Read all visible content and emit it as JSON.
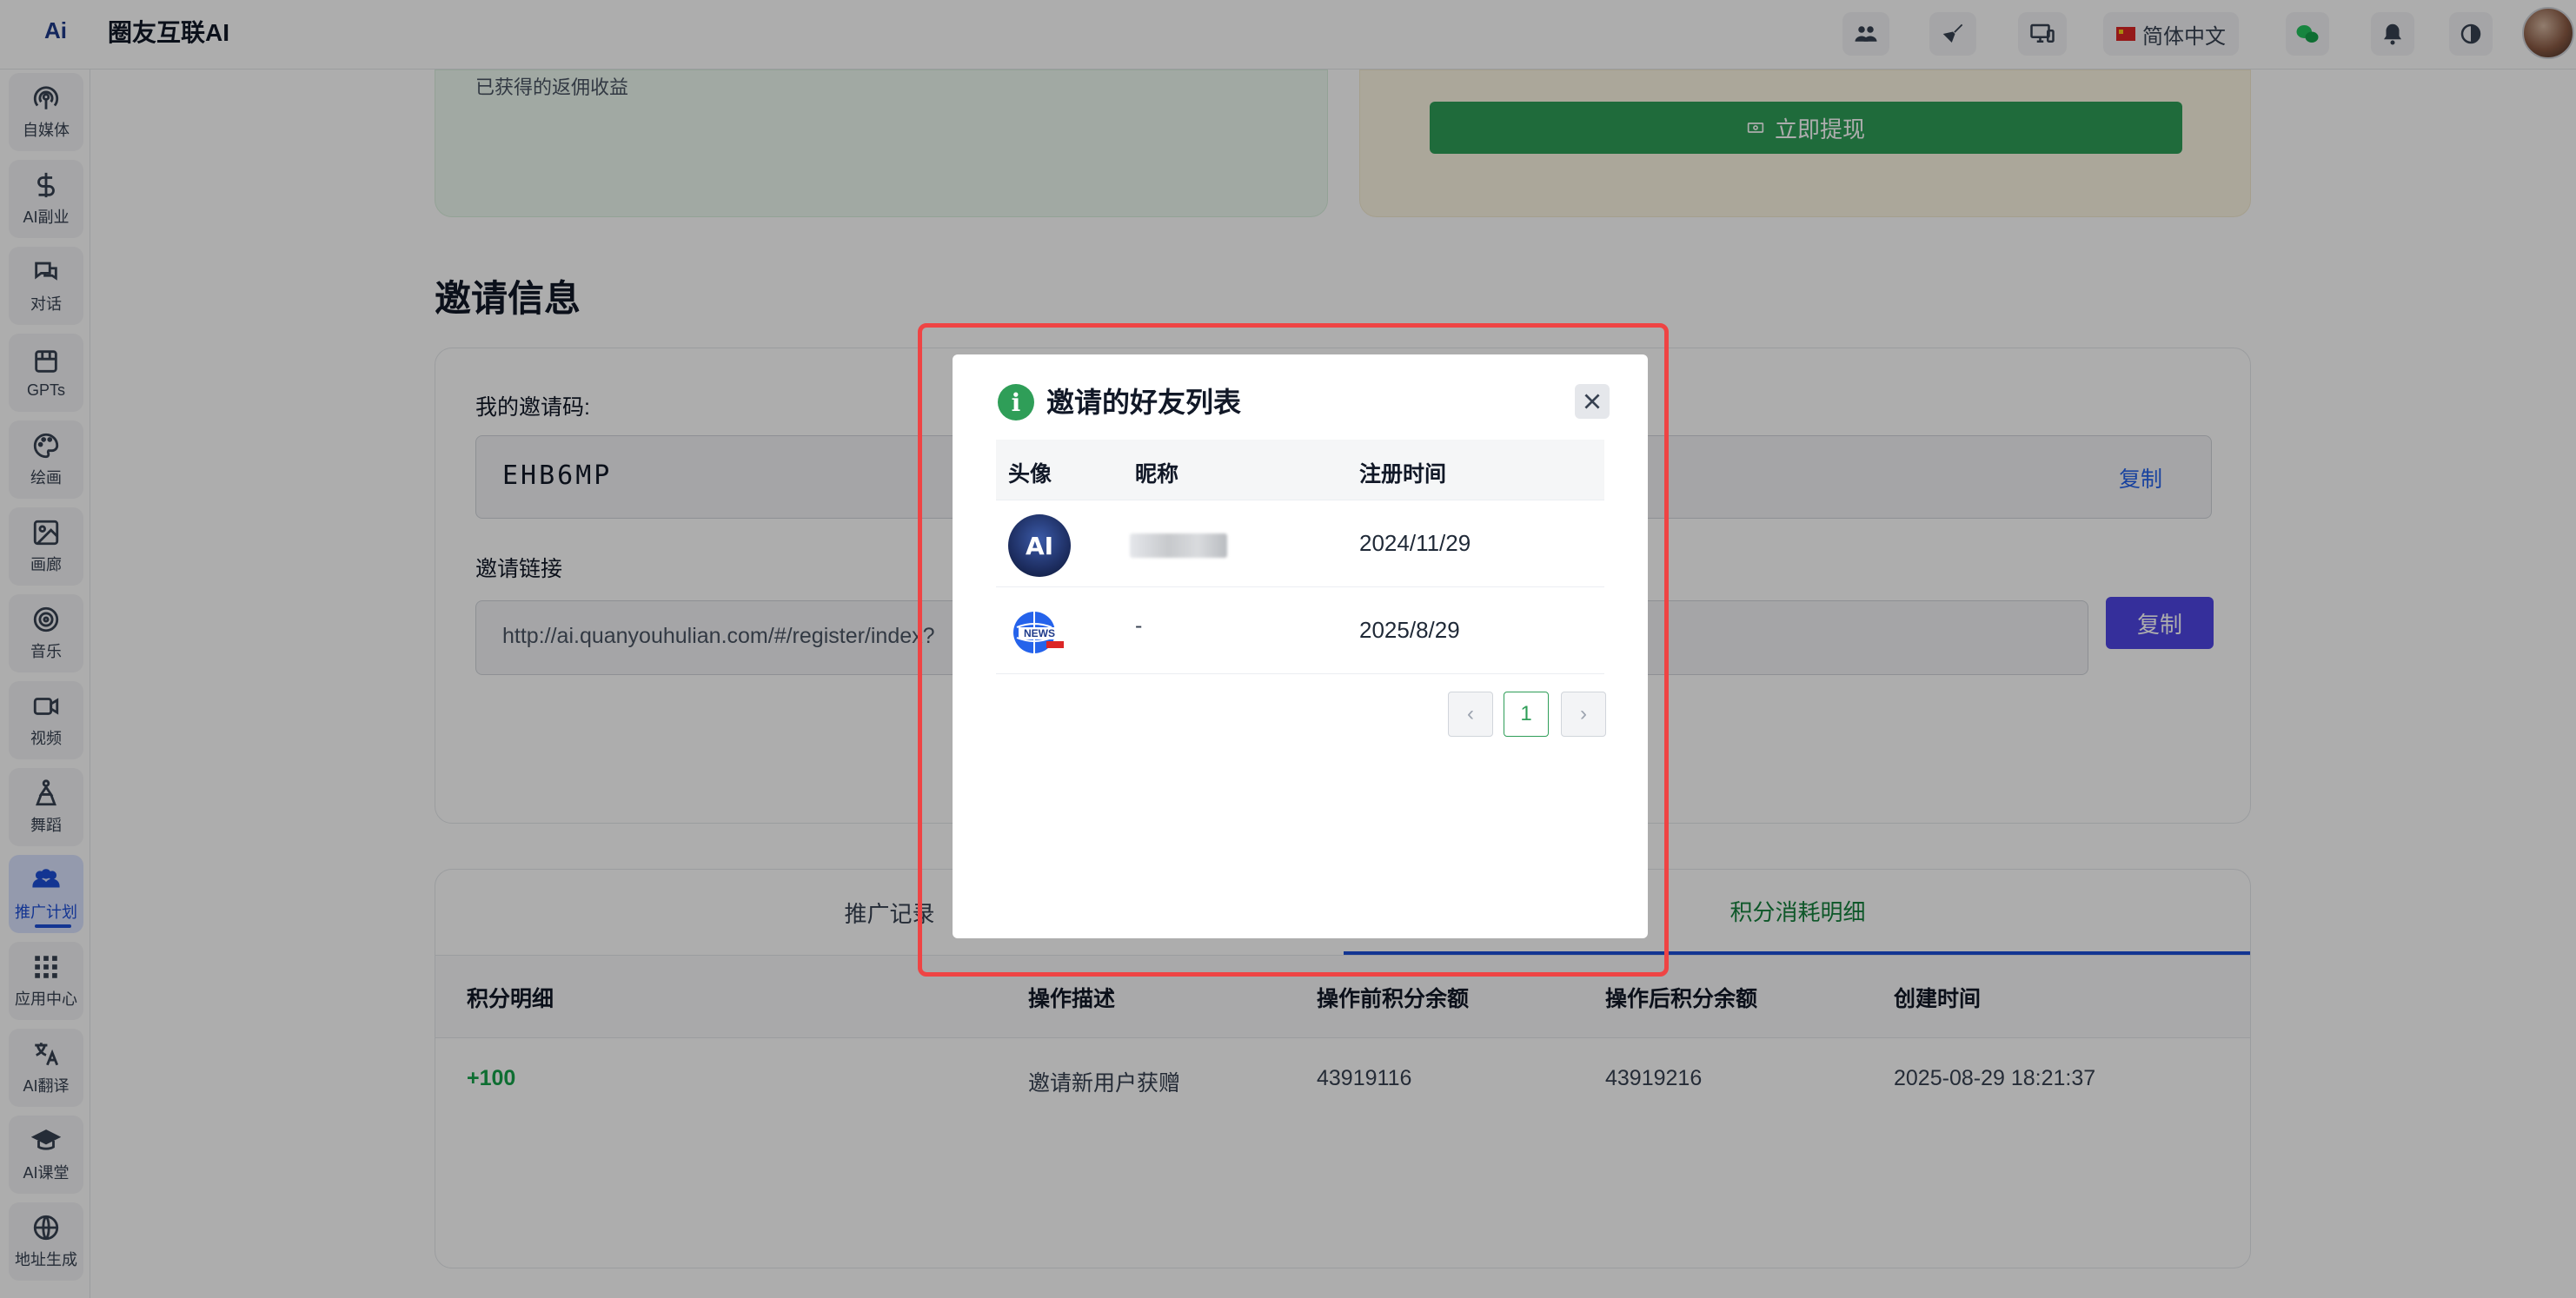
{
  "app": {
    "logo_text": "Ai",
    "title": "圈友互联AI"
  },
  "topbar": {
    "language": "简体中文"
  },
  "sidebar": {
    "items": [
      {
        "label": "自媒体",
        "icon": "broadcast-icon"
      },
      {
        "label": "AI副业",
        "icon": "dollar-icon"
      },
      {
        "label": "对话",
        "icon": "chat-icon"
      },
      {
        "label": "GPTs",
        "icon": "store-icon"
      },
      {
        "label": "绘画",
        "icon": "palette-icon"
      },
      {
        "label": "画廊",
        "icon": "image-icon"
      },
      {
        "label": "音乐",
        "icon": "music-icon"
      },
      {
        "label": "视频",
        "icon": "video-icon"
      },
      {
        "label": "舞蹈",
        "icon": "dance-icon"
      },
      {
        "label": "推广计划",
        "icon": "users-icon",
        "active": true
      },
      {
        "label": "应用中心",
        "icon": "grid-icon"
      },
      {
        "label": "AI翻译",
        "icon": "translate-icon"
      },
      {
        "label": "AI课堂",
        "icon": "graduation-icon"
      },
      {
        "label": "地址生成",
        "icon": "globe-icon"
      }
    ]
  },
  "earnings": {
    "label": "已获得的返佣收益",
    "withdraw_button": "立即提现"
  },
  "invite": {
    "section_title": "邀请信息",
    "code_label": "我的邀请码:",
    "code": "EHB6MP",
    "copy_text": "复制",
    "link_label": "邀请链接",
    "link": "http://ai.quanyouhulian.com/#/register/index?",
    "copy_button": "复制"
  },
  "records": {
    "tabs": [
      "推广记录",
      "积分消耗明细"
    ],
    "columns": [
      "积分明细",
      "操作描述",
      "操作前积分余额",
      "操作后积分余额",
      "创建时间"
    ],
    "rows": [
      {
        "points": "+100",
        "description": "邀请新用户获赠",
        "before": "43919116",
        "after": "43919216",
        "created": "2025-08-29 18:21:37"
      }
    ]
  },
  "dialog": {
    "title": "邀请的好友列表",
    "columns": [
      "头像",
      "昵称",
      "注册时间"
    ],
    "rows": [
      {
        "avatar_text": "AI",
        "nickname": "",
        "registered": "2024/11/29"
      },
      {
        "avatar_text": "NEWS",
        "nickname": "-",
        "registered": "2025/8/29"
      }
    ],
    "pagination": {
      "current_page": "1"
    }
  },
  "colors": {
    "primary_green": "#2f9e58",
    "accent_blue": "#1d4ed8",
    "highlight_red": "#ef4444",
    "copy_purple": "#4f46e5"
  }
}
